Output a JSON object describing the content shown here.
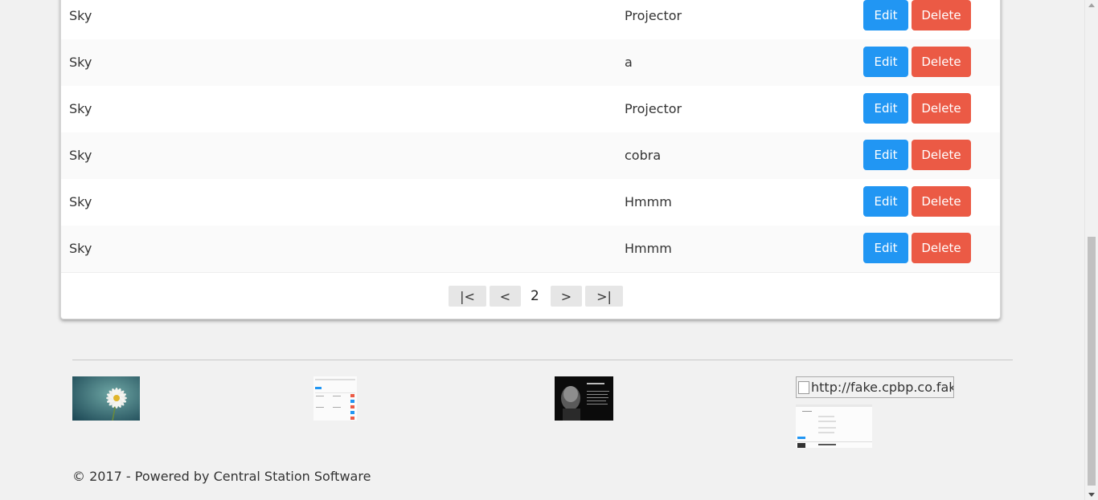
{
  "table": {
    "rows": [
      {
        "col1": "Sky",
        "col2": "Projector"
      },
      {
        "col1": "Sky",
        "col2": "a"
      },
      {
        "col1": "Sky",
        "col2": "Projector"
      },
      {
        "col1": "Sky",
        "col2": "cobra"
      },
      {
        "col1": "Sky",
        "col2": "Hmmm"
      },
      {
        "col1": "Sky",
        "col2": "Hmmm"
      }
    ],
    "edit_label": "Edit",
    "delete_label": "Delete"
  },
  "pagination": {
    "first": "|<",
    "prev": "<",
    "current": "2",
    "next": ">",
    "last": ">|"
  },
  "gallery": {
    "broken_image_alt": "http://fake.cpbp.co.fake"
  },
  "footer": {
    "text": "© 2017 - Powered by Central Station Software"
  },
  "colors": {
    "edit": "#2196f3",
    "delete": "#eb5a45"
  }
}
